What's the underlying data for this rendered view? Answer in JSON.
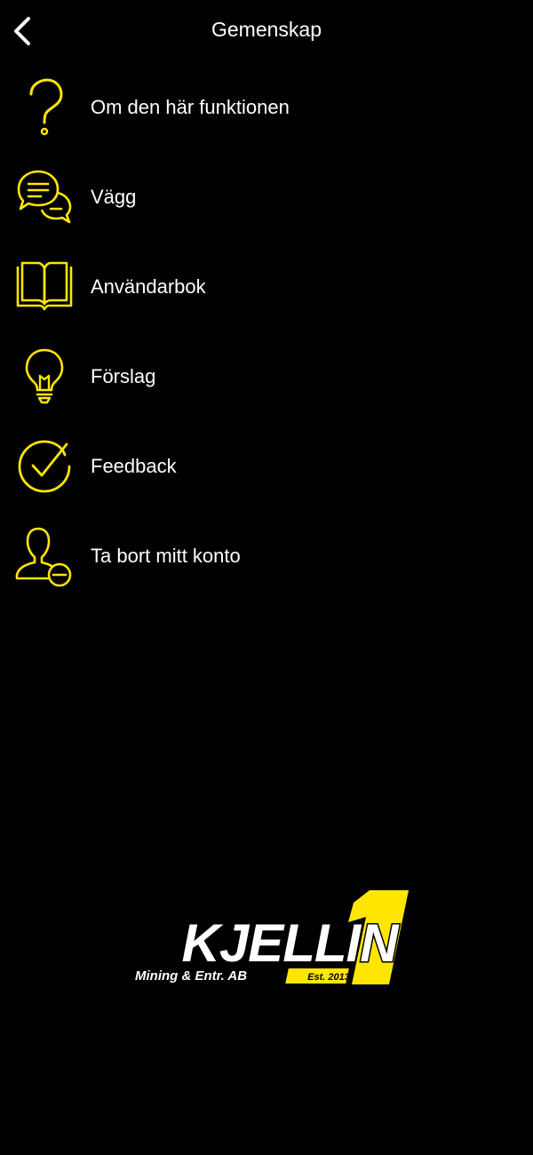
{
  "header": {
    "title": "Gemenskap",
    "back_icon": "chevron-left-icon"
  },
  "menu": {
    "items": [
      {
        "label": "Om den här funktionen",
        "icon": "question-mark-icon"
      },
      {
        "label": "Vägg",
        "icon": "chat-bubbles-icon"
      },
      {
        "label": "Användarbok",
        "icon": "open-book-icon"
      },
      {
        "label": "Förslag",
        "icon": "lightbulb-icon"
      },
      {
        "label": "Feedback",
        "icon": "check-circle-icon"
      },
      {
        "label": "Ta bort mitt konto",
        "icon": "remove-user-icon"
      }
    ]
  },
  "logo": {
    "name": "KJELLIN",
    "subtitle": "Mining & Entr. AB",
    "badge": "Est. 2013",
    "digit": "1"
  },
  "colors": {
    "background": "#000000",
    "text": "#ffffff",
    "accent": "#ffe600"
  }
}
